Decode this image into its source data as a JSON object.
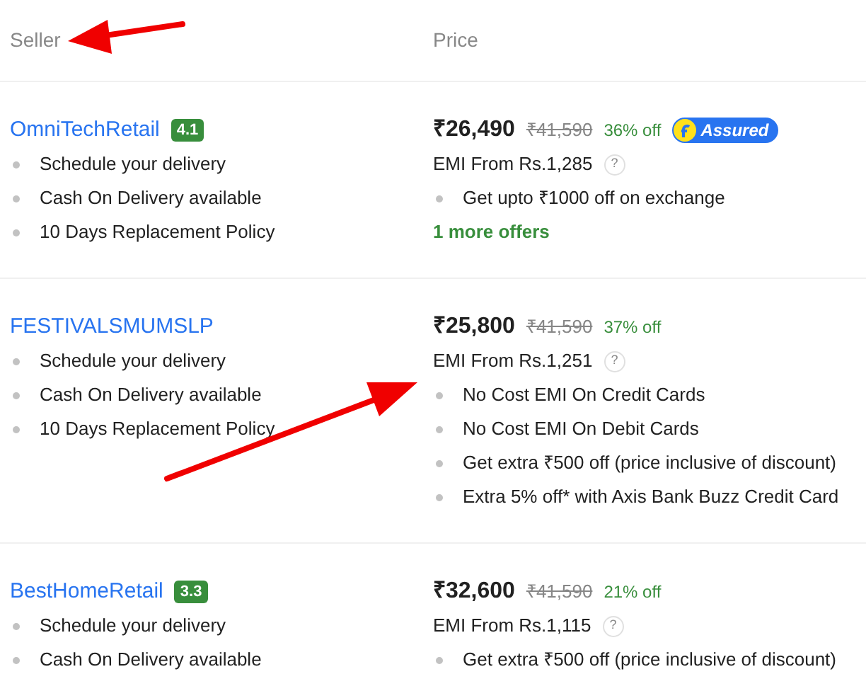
{
  "columns": [
    "Seller",
    "Price"
  ],
  "sellers": [
    {
      "name": "OmniTechRetail",
      "rating": "4.1",
      "features": [
        "Schedule your delivery",
        "Cash On Delivery available",
        "10 Days Replacement Policy"
      ],
      "price": "₹26,490",
      "mrp": "₹41,590",
      "discount": "36% off",
      "assured_label": "Assured",
      "emi": "EMI From Rs.1,285",
      "emi_help": "?",
      "offers": [
        "Get upto ₹1000 off on exchange"
      ],
      "more_offers": "1 more offers"
    },
    {
      "name": "FESTIVALSMUMSLP",
      "features": [
        "Schedule your delivery",
        "Cash On Delivery available",
        "10 Days Replacement Policy"
      ],
      "price": "₹25,800",
      "mrp": "₹41,590",
      "discount": "37% off",
      "emi": "EMI From Rs.1,251",
      "emi_help": "?",
      "offers": [
        "No Cost EMI On Credit Cards",
        "No Cost EMI On Debit Cards",
        "Get extra ₹500 off (price inclusive of discount)",
        "Extra 5% off* with Axis Bank Buzz Credit Card"
      ]
    },
    {
      "name": "BestHomeRetail",
      "rating": "3.3",
      "features": [
        "Schedule your delivery",
        "Cash On Delivery available"
      ],
      "price": "₹32,600",
      "mrp": "₹41,590",
      "discount": "21% off",
      "emi": "EMI From Rs.1,115",
      "emi_help": "?",
      "offers": [
        "Get extra ₹500 off (price inclusive of discount)"
      ]
    }
  ]
}
